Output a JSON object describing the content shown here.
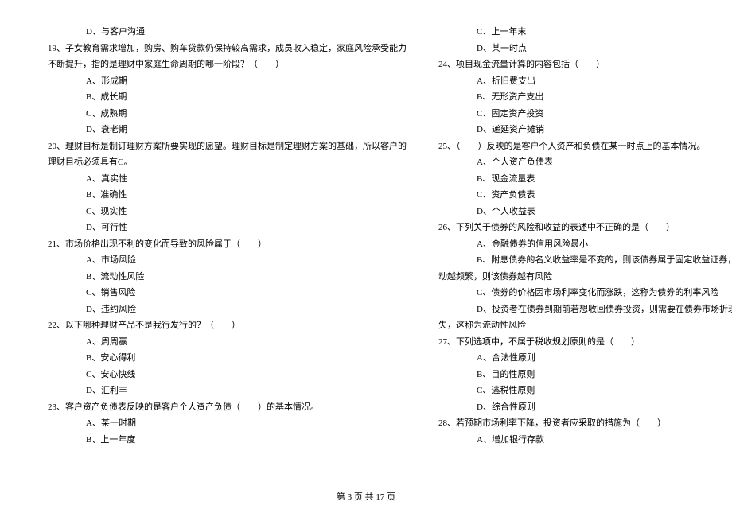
{
  "left": {
    "q18_d": "D、与客户沟通",
    "q19_text1": "19、子女教育需求增加，购房、购车贷款仍保持较高需求，成员收入稳定，家庭风险承受能力",
    "q19_text2": "不断提升，指的是理财中家庭生命周期的哪一阶段？（　　）",
    "q19_a": "A、形成期",
    "q19_b": "B、成长期",
    "q19_c": "C、成熟期",
    "q19_d": "D、衰老期",
    "q20_text1": "20、理财目标是制订理财方案所要实现的愿望。理财目标是制定理财方案的基础，所以客户的",
    "q20_text2": "理财目标必须具有C。",
    "q20_a": "A、真实性",
    "q20_b": "B、准确性",
    "q20_c": "C、现实性",
    "q20_d": "D、可行性",
    "q21_text": "21、市场价格出现不利的变化而导致的风险属于（　　）",
    "q21_a": "A、市场风险",
    "q21_b": "B、流动性风险",
    "q21_c": "C、销售风险",
    "q21_d": "D、违约风险",
    "q22_text": "22、以下哪种理财产品不是我行发行的？（　　）",
    "q22_a": "A、周周赢",
    "q22_b": "B、安心得利",
    "q22_c": "C、安心快线",
    "q22_d": "D、汇利丰",
    "q23_text": "23、客户资产负债表反映的是客户个人资产负债（　　）的基本情况。",
    "q23_a": "A、某一时期",
    "q23_b": "B、上一年度"
  },
  "right": {
    "q23_c": "C、上一年末",
    "q23_d": "D、某一时点",
    "q24_text": "24、项目现金流量计算的内容包括（　　）",
    "q24_a": "A、折旧费支出",
    "q24_b": "B、无形资产支出",
    "q24_c": "C、固定资产投资",
    "q24_d": "D、递延资产摊销",
    "q25_text": "25、（　　）反映的是客户个人资产和负债在某一时点上的基本情况。",
    "q25_a": "A、个人资产负债表",
    "q25_b": "B、现金流量表",
    "q25_c": "C、资产负债表",
    "q25_d": "D、个人收益表",
    "q26_text": "26、下列关于债券的风险和收益的表述中不正确的是（　　）",
    "q26_a": "A、金融债券的信用风险最小",
    "q26_b1": "B、附息债券的名义收益率是不变的，则该债券属于固定收益证券，但实际上债券的价格变",
    "q26_b2": "动越频繁，则该债券越有风险",
    "q26_c": "C、债券的价格因市场利率变化而涨跌，这称为债券的利率风险",
    "q26_d1": "D、投资者在债券到期前若想收回债券投资，则需要在债券市场折现，从而可能带来一定损",
    "q26_d2": "失，这称为流动性风险",
    "q27_text": "27、下列选项中，不属于税收规划原则的是（　　）",
    "q27_a": "A、合法性原则",
    "q27_b": "B、目的性原则",
    "q27_c": "C、逃税性原则",
    "q27_d": "D、综合性原则",
    "q28_text": "28、若预期市场利率下降，投资者应采取的措施为（　　）",
    "q28_a": "A、增加银行存款"
  },
  "footer": "第 3 页 共 17 页"
}
